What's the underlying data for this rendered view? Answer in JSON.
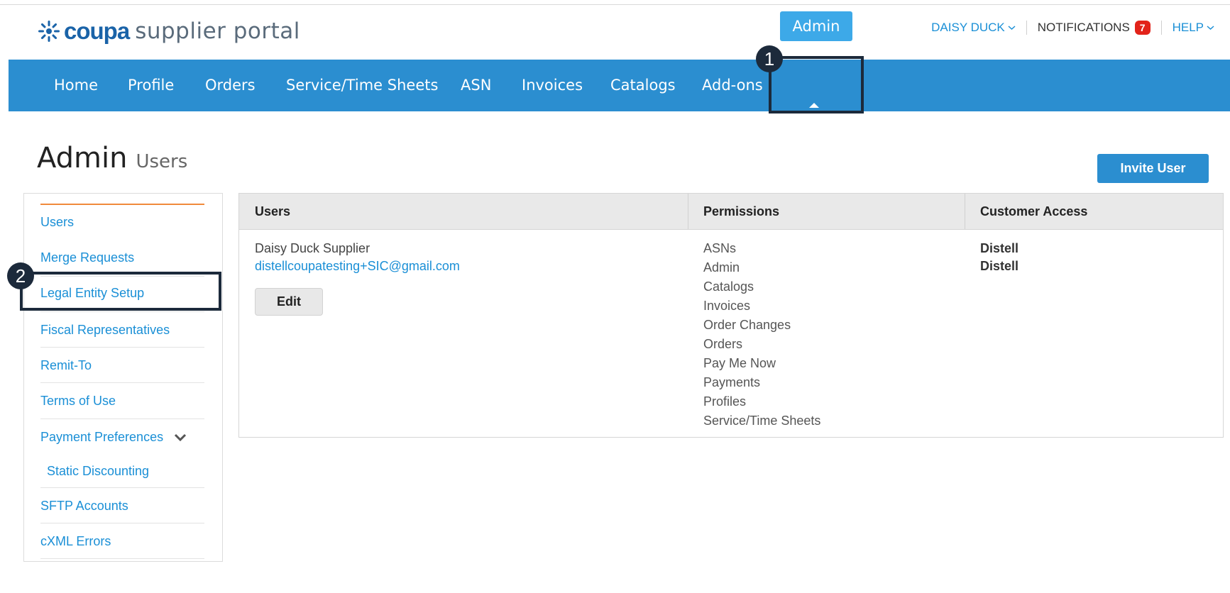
{
  "header": {
    "logo_brand": "coupa",
    "logo_suffix": "supplier portal",
    "user_name": "DAISY DUCK",
    "notifications_label": "NOTIFICATIONS",
    "notifications_count": "7",
    "help_label": "HELP",
    "brand_color": "#1a63a8",
    "badge_color": "#e2231a"
  },
  "nav": {
    "bar_color": "#2b8ed0",
    "items": [
      {
        "label": "Home"
      },
      {
        "label": "Profile"
      },
      {
        "label": "Orders"
      },
      {
        "label": "Service/Time Sheets"
      },
      {
        "label": "ASN"
      },
      {
        "label": "Invoices"
      },
      {
        "label": "Catalogs"
      },
      {
        "label": "Add-ons"
      },
      {
        "label": "Admin",
        "active": true
      }
    ]
  },
  "callouts": {
    "one": "1",
    "two": "2"
  },
  "page": {
    "title": "Admin",
    "subtitle": "Users",
    "invite_button": "Invite User"
  },
  "sidebar": {
    "accent_color": "#f08a3c",
    "items": [
      {
        "label": "Users"
      },
      {
        "label": "Merge Requests"
      },
      {
        "label": "Legal Entity Setup"
      },
      {
        "label": "Fiscal Representatives"
      },
      {
        "label": "Remit-To"
      },
      {
        "label": "Terms of Use"
      },
      {
        "label": "Payment Preferences",
        "icon": "chevron-down-icon"
      },
      {
        "label": "Static Discounting"
      },
      {
        "label": "SFTP Accounts"
      },
      {
        "label": "cXML Errors"
      }
    ]
  },
  "table": {
    "headers": [
      "Users",
      "Permissions",
      "Customer Access"
    ],
    "rows": [
      {
        "user_name": "Daisy Duck Supplier",
        "user_email": "distellcoupatesting+SIC@gmail.com",
        "edit_label": "Edit",
        "permissions": [
          "ASNs",
          "Admin",
          "Catalogs",
          "Invoices",
          "Order Changes",
          "Orders",
          "Pay Me Now",
          "Payments",
          "Profiles",
          "Service/Time Sheets"
        ],
        "customer_access": [
          "Distell",
          "Distell"
        ]
      }
    ]
  }
}
